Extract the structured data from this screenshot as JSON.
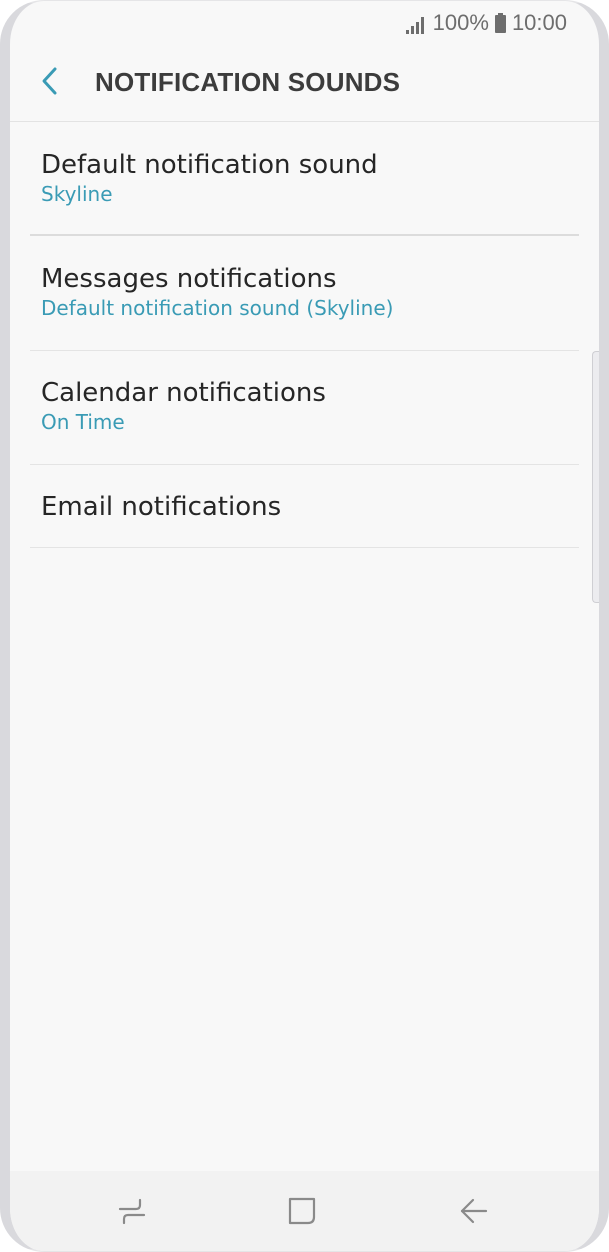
{
  "status_bar": {
    "battery_percent": "100%",
    "time": "10:00",
    "icons": [
      "signal-icon",
      "battery-icon"
    ]
  },
  "header": {
    "back_icon": "chevron-left-icon",
    "title": "NOTIFICATION SOUNDS"
  },
  "items": [
    {
      "title": "Default notification sound",
      "subtitle": "Skyline"
    },
    {
      "title": "Messages notifications",
      "subtitle": "Default notification sound (Skyline)"
    },
    {
      "title": "Calendar notifications",
      "subtitle": "On Time"
    },
    {
      "title": "Email notifications"
    }
  ],
  "nav_bar": {
    "icons": [
      "recents-icon",
      "home-icon",
      "back-arrow-icon"
    ]
  },
  "colors": {
    "accent": "#3a9bb5",
    "background": "#f8f8f8",
    "title_text": "#3c3c3c",
    "item_text": "#262626"
  }
}
